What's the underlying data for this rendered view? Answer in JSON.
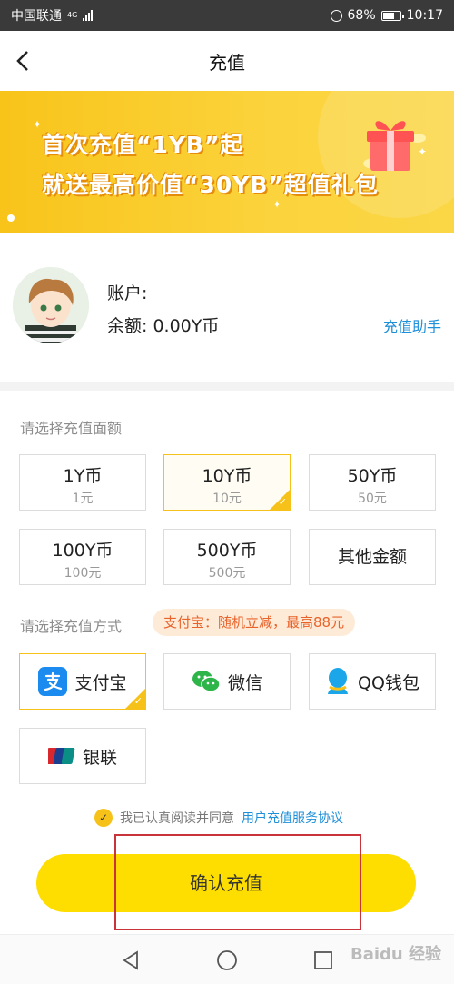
{
  "status_bar": {
    "carrier": "中国联通",
    "network": "4G",
    "battery": "68%",
    "time": "10:17"
  },
  "header": {
    "title": "充值"
  },
  "banner": {
    "line1": "首次充值“1YB”起",
    "line2": "就送最高价值“30YB”超值礼包"
  },
  "account": {
    "label": "账户:",
    "balance": "余额: 0.00Y币",
    "help": "充值助手"
  },
  "amount_section": {
    "label": "请选择充值面额",
    "options": [
      {
        "coins": "1Y币",
        "price": "1元"
      },
      {
        "coins": "10Y币",
        "price": "10元"
      },
      {
        "coins": "50Y币",
        "price": "50元"
      },
      {
        "coins": "100Y币",
        "price": "100元"
      },
      {
        "coins": "500Y币",
        "price": "500元"
      },
      {
        "coins": "其他金额",
        "price": ""
      }
    ]
  },
  "payment_section": {
    "label": "请选择充值方式",
    "promo": "支付宝：随机立减，最高88元",
    "methods": [
      "支付宝",
      "微信",
      "QQ钱包",
      "银联"
    ]
  },
  "agreement": {
    "text": "我已认真阅读并同意",
    "link": "用户充值服务协议"
  },
  "confirm_button": "确认充值",
  "watermark": "Baidu 经验",
  "colors": {
    "accent": "#fede00",
    "selected_border": "#f6c21a",
    "link": "#1e8fd9",
    "promo_text": "#e8622a",
    "annotation_box": "#c9343a"
  }
}
